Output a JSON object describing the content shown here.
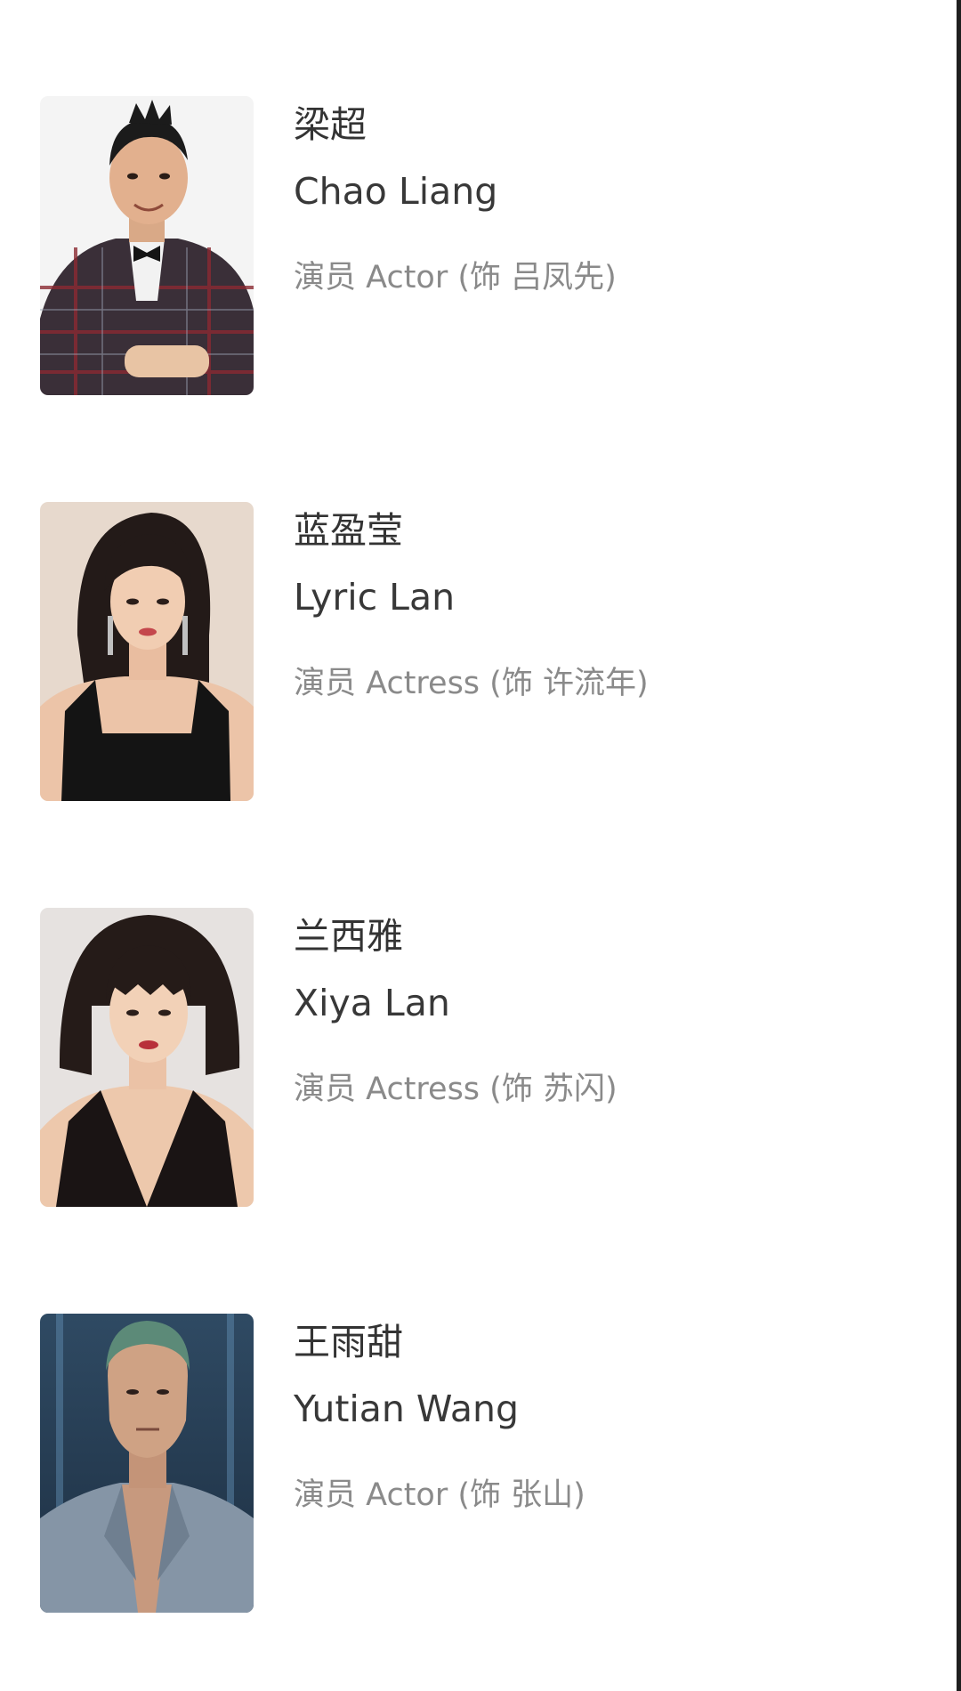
{
  "cast": [
    {
      "name_zh": "梁超",
      "name_en": "Chao Liang",
      "role": "演员 Actor (饰 吕凤先)"
    },
    {
      "name_zh": "蓝盈莹",
      "name_en": "Lyric Lan",
      "role": "演员 Actress (饰 许流年)"
    },
    {
      "name_zh": "兰西雅",
      "name_en": "Xiya Lan",
      "role": "演员 Actress (饰 苏闪)"
    },
    {
      "name_zh": "王雨甜",
      "name_en": "Yutian Wang",
      "role": "演员 Actor (饰 张山)"
    }
  ]
}
